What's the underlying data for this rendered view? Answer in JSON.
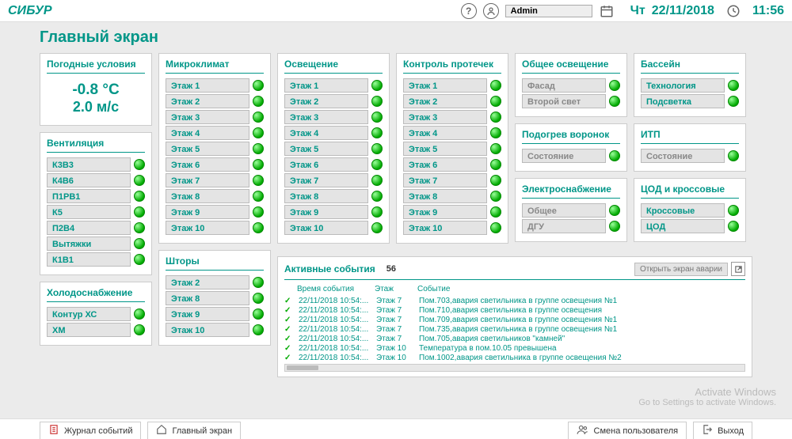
{
  "header": {
    "logo": "СИБУР",
    "help_icon": "?",
    "user_icon": "user",
    "user_value": "Admin",
    "calendar_icon": "calendar",
    "day": "Чт",
    "date": "22/11/2018",
    "clock_icon": "clock",
    "time": "11:56"
  },
  "page_title": "Главный экран",
  "weather": {
    "title": "Погодные условия",
    "temp": "-0.8 °C",
    "wind": "2.0 м/с"
  },
  "ventilation": {
    "title": "Вентиляция",
    "items": [
      "К3В3",
      "К4В6",
      "П1РВ1",
      "К5",
      "П2В4",
      "Вытяжки",
      "К1В1"
    ]
  },
  "cooling": {
    "title": "Холодоснабжение",
    "items": [
      "Контур ХС",
      "ХМ"
    ]
  },
  "microclimate": {
    "title": "Микроклимат",
    "items": [
      "Этаж 1",
      "Этаж 2",
      "Этаж 3",
      "Этаж 4",
      "Этаж 5",
      "Этаж 6",
      "Этаж 7",
      "Этаж 8",
      "Этаж 9",
      "Этаж 10"
    ]
  },
  "blinds": {
    "title": "Шторы",
    "items": [
      "Этаж 2",
      "Этаж 8",
      "Этаж 9",
      "Этаж 10"
    ]
  },
  "lighting": {
    "title": "Освещение",
    "items": [
      "Этаж 1",
      "Этаж 2",
      "Этаж 3",
      "Этаж 4",
      "Этаж 5",
      "Этаж 6",
      "Этаж 7",
      "Этаж 8",
      "Этаж 9",
      "Этаж 10"
    ]
  },
  "leak": {
    "title": "Контроль протечек",
    "items": [
      "Этаж 1",
      "Этаж 2",
      "Этаж 3",
      "Этаж 4",
      "Этаж 5",
      "Этаж 6",
      "Этаж 7",
      "Этаж 8",
      "Этаж 9",
      "Этаж 10"
    ]
  },
  "general_light": {
    "title": "Общее освещение",
    "items": [
      "Фасад",
      "Второй свет"
    ]
  },
  "funnel": {
    "title": "Подогрев воронок",
    "items": [
      "Состояние"
    ]
  },
  "power": {
    "title": "Электроснабжение",
    "items": [
      "Общее",
      "ДГУ"
    ]
  },
  "pool": {
    "title": "Бассейн",
    "items": [
      "Технология",
      "Подсветка"
    ]
  },
  "itp": {
    "title": "ИТП",
    "items": [
      "Состояние"
    ]
  },
  "datacenter": {
    "title": "ЦОД и кроссовые",
    "items": [
      "Кроссовые",
      "ЦОД"
    ]
  },
  "events": {
    "title": "Активные события",
    "count": "56",
    "open_label": "Открыть экран аварии",
    "cols": {
      "time": "Время события",
      "floor": "Этаж",
      "event": "Событие"
    },
    "rows": [
      {
        "time": "22/11/2018 10:54:...",
        "floor": "Этаж 7",
        "msg": "Пом.703,авария светильника в группе освещения №1"
      },
      {
        "time": "22/11/2018 10:54:...",
        "floor": "Этаж 7",
        "msg": "Пом.710,авария светильника в группе освещения"
      },
      {
        "time": "22/11/2018 10:54:...",
        "floor": "Этаж 7",
        "msg": "Пом.709,авария светильника в группе освещения №1"
      },
      {
        "time": "22/11/2018 10:54:...",
        "floor": "Этаж 7",
        "msg": "Пом.735,авария светильника в группе освещения №1"
      },
      {
        "time": "22/11/2018 10:54:...",
        "floor": "Этаж 7",
        "msg": "Пом.705,авария светильников \"камней\""
      },
      {
        "time": "22/11/2018 10:54:...",
        "floor": "Этаж 10",
        "msg": "Температура в пом.10.05 превышена"
      },
      {
        "time": "22/11/2018 10:54:...",
        "floor": "Этаж 10",
        "msg": "Пом.1002,авария светильника в группе освещения №2"
      }
    ]
  },
  "watermark": {
    "line1": "Activate Windows",
    "line2": "Go to Settings to activate Windows."
  },
  "bottom": {
    "journal": "Журнал событий",
    "main": "Главный экран",
    "change_user": "Смена пользователя",
    "exit": "Выход"
  }
}
